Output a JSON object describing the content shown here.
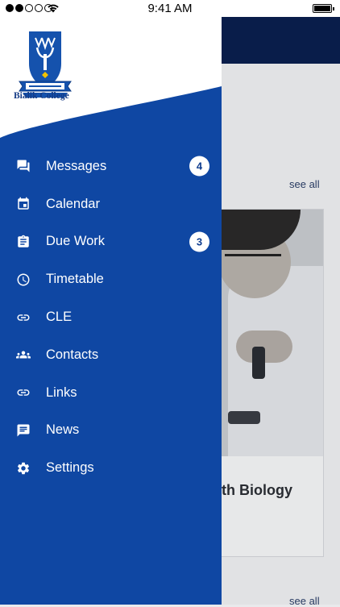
{
  "status_bar": {
    "time": "9:41 AM"
  },
  "school": {
    "name": "Bialik College"
  },
  "menu": [
    {
      "label": "Messages",
      "icon": "messages-icon",
      "badge": "4"
    },
    {
      "label": "Calendar",
      "icon": "calendar-icon",
      "badge": ""
    },
    {
      "label": "Due Work",
      "icon": "clipboard-icon",
      "badge": "3"
    },
    {
      "label": "Timetable",
      "icon": "clock-icon",
      "badge": ""
    },
    {
      "label": "CLE",
      "icon": "link-icon",
      "badge": ""
    },
    {
      "label": "Contacts",
      "icon": "people-icon",
      "badge": ""
    },
    {
      "label": "Links",
      "icon": "link-icon",
      "badge": ""
    },
    {
      "label": "News",
      "icon": "news-icon",
      "badge": ""
    },
    {
      "label": "Settings",
      "icon": "gear-icon",
      "badge": ""
    }
  ],
  "background": {
    "see_all_label": "see all",
    "card_title": "ith Biology"
  },
  "colors": {
    "drawer": "#0f47a3",
    "header": "#0a1f4f",
    "badge_text": "#0f3d8f"
  }
}
